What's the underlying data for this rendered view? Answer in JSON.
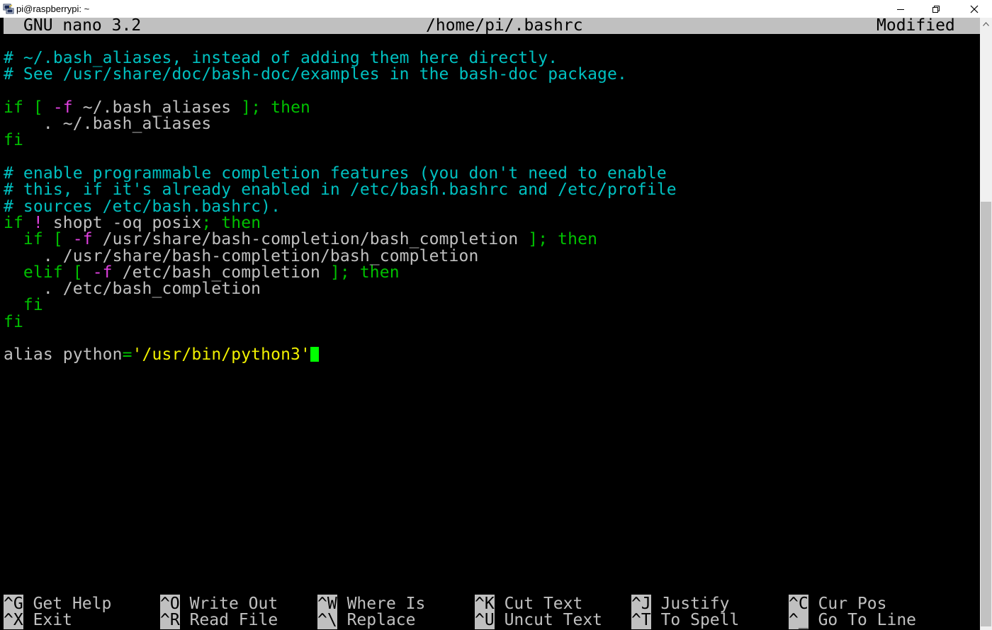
{
  "window": {
    "title": "pi@raspberrypi: ~"
  },
  "header": {
    "app": "GNU nano 3.2",
    "file": "/home/pi/.bashrc",
    "status": "Modified"
  },
  "editor": {
    "l1": "# ~/.bash_aliases, instead of adding them here directly.",
    "l2": "# See /usr/share/doc/bash-doc/examples in the bash-doc package.",
    "l3_if": "if",
    "l3_b1": " [ ",
    "l3_f": "-f",
    "l3_path": " ~/.bash_aliases ",
    "l3_b2": "];",
    "l3_then": " then",
    "l4": "    . ~/.bash_aliases",
    "l5": "fi",
    "l6": "# enable programmable completion features (you don't need to enable",
    "l7": "# this, if it's already enabled in /etc/bash.bashrc and /etc/profile",
    "l8": "# sources /etc/bash.bashrc).",
    "l9_if": "if",
    "l9_not": " !",
    "l9_cmd": " shopt -oq posix",
    "l9_semi": ";",
    "l9_then": " then",
    "l10_if": "  if",
    "l10_b1": " [ ",
    "l10_f": "-f",
    "l10_path": " /usr/share/bash-completion/bash_completion ",
    "l10_b2": "];",
    "l10_then": " then",
    "l11": "    . /usr/share/bash-completion/bash_completion",
    "l12_elif": "  elif",
    "l12_b1": " [ ",
    "l12_f": "-f",
    "l12_path": " /etc/bash_completion ",
    "l12_b2": "];",
    "l12_then": " then",
    "l13": "    . /etc/bash_completion",
    "l14": "  fi",
    "l15": "fi",
    "l16_alias": "alias python",
    "l16_eq": "=",
    "l16_str": "'/usr/bin/python3'"
  },
  "shortcuts": [
    {
      "key": "^G",
      "label": "Get Help"
    },
    {
      "key": "^X",
      "label": "Exit"
    },
    {
      "key": "^O",
      "label": "Write Out"
    },
    {
      "key": "^R",
      "label": "Read File"
    },
    {
      "key": "^W",
      "label": "Where Is"
    },
    {
      "key": "^\\",
      "label": "Replace"
    },
    {
      "key": "^K",
      "label": "Cut Text"
    },
    {
      "key": "^U",
      "label": "Uncut Text"
    },
    {
      "key": "^J",
      "label": "Justify"
    },
    {
      "key": "^T",
      "label": "To Spell"
    },
    {
      "key": "^C",
      "label": "Cur Pos"
    },
    {
      "key": "^_",
      "label": "Go To Line"
    }
  ],
  "colors": {
    "comment": "#00c0c0",
    "keyword": "#00c000",
    "flag": "#e040e0",
    "string": "#f0f000",
    "cursor": "#00ff00",
    "header_bg": "#c0c0c0"
  }
}
